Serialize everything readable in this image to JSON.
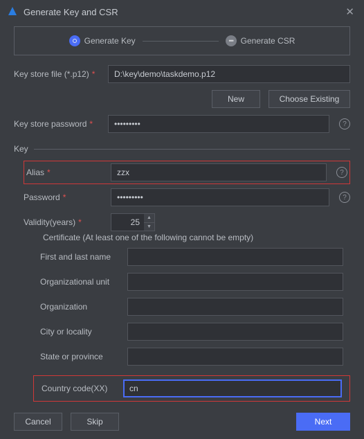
{
  "window": {
    "title": "Generate Key and CSR"
  },
  "stepper": {
    "step1": "Generate Key",
    "step2": "Generate CSR"
  },
  "keystore": {
    "file_label": "Key store file (*.p12)",
    "file_value": "D:\\key\\demo\\taskdemo.p12",
    "btn_new": "New",
    "btn_choose": "Choose Existing",
    "pw_label": "Key store password",
    "pw_value": "•••••••••"
  },
  "key": {
    "section_label": "Key",
    "alias_label": "Alias",
    "alias_value": "zzx",
    "pw_label": "Password",
    "pw_value": "•••••••••",
    "validity_label": "Validity(years)",
    "validity_value": "25"
  },
  "cert": {
    "legend": "Certificate (At least one of the following cannot be empty)",
    "firstname_label": "First and last name",
    "firstname_value": "",
    "orgunit_label": "Organizational unit",
    "orgunit_value": "",
    "org_label": "Organization",
    "org_value": "",
    "city_label": "City or locality",
    "city_value": "",
    "state_label": "State or province",
    "state_value": "",
    "country_label": "Country code(XX)",
    "country_value": "cn"
  },
  "footer": {
    "cancel": "Cancel",
    "skip": "Skip",
    "next": "Next"
  },
  "req_mark": "*"
}
